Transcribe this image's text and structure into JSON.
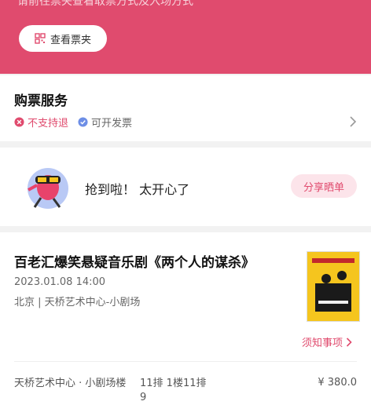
{
  "banner": {
    "hint_text": "请前往票夹查看取票方式及入场方式",
    "view_ticket_label": "查看票夹",
    "accent_color": "#e04b6e"
  },
  "service": {
    "title": "购票服务",
    "tags": [
      {
        "label": "不支持退",
        "icon": "x-circle-icon",
        "color": "#e04b6e"
      },
      {
        "label": "可开发票",
        "icon": "check-circle-icon",
        "color": "#6d8ee6"
      }
    ]
  },
  "share": {
    "message": "抢到啦！ 太开心了",
    "button_label": "分享晒单"
  },
  "show": {
    "title": "百老汇爆笑悬疑音乐剧《两个人的谋杀》",
    "datetime": "2023.01.08 14:00",
    "location": "北京 | 天桥艺术中心-小剧场",
    "notice_label": "须知事项"
  },
  "order": {
    "venue": "天桥艺术中心 · 小剧场楼",
    "seat": "11排 1楼11排9",
    "price": "¥ 380.0"
  }
}
